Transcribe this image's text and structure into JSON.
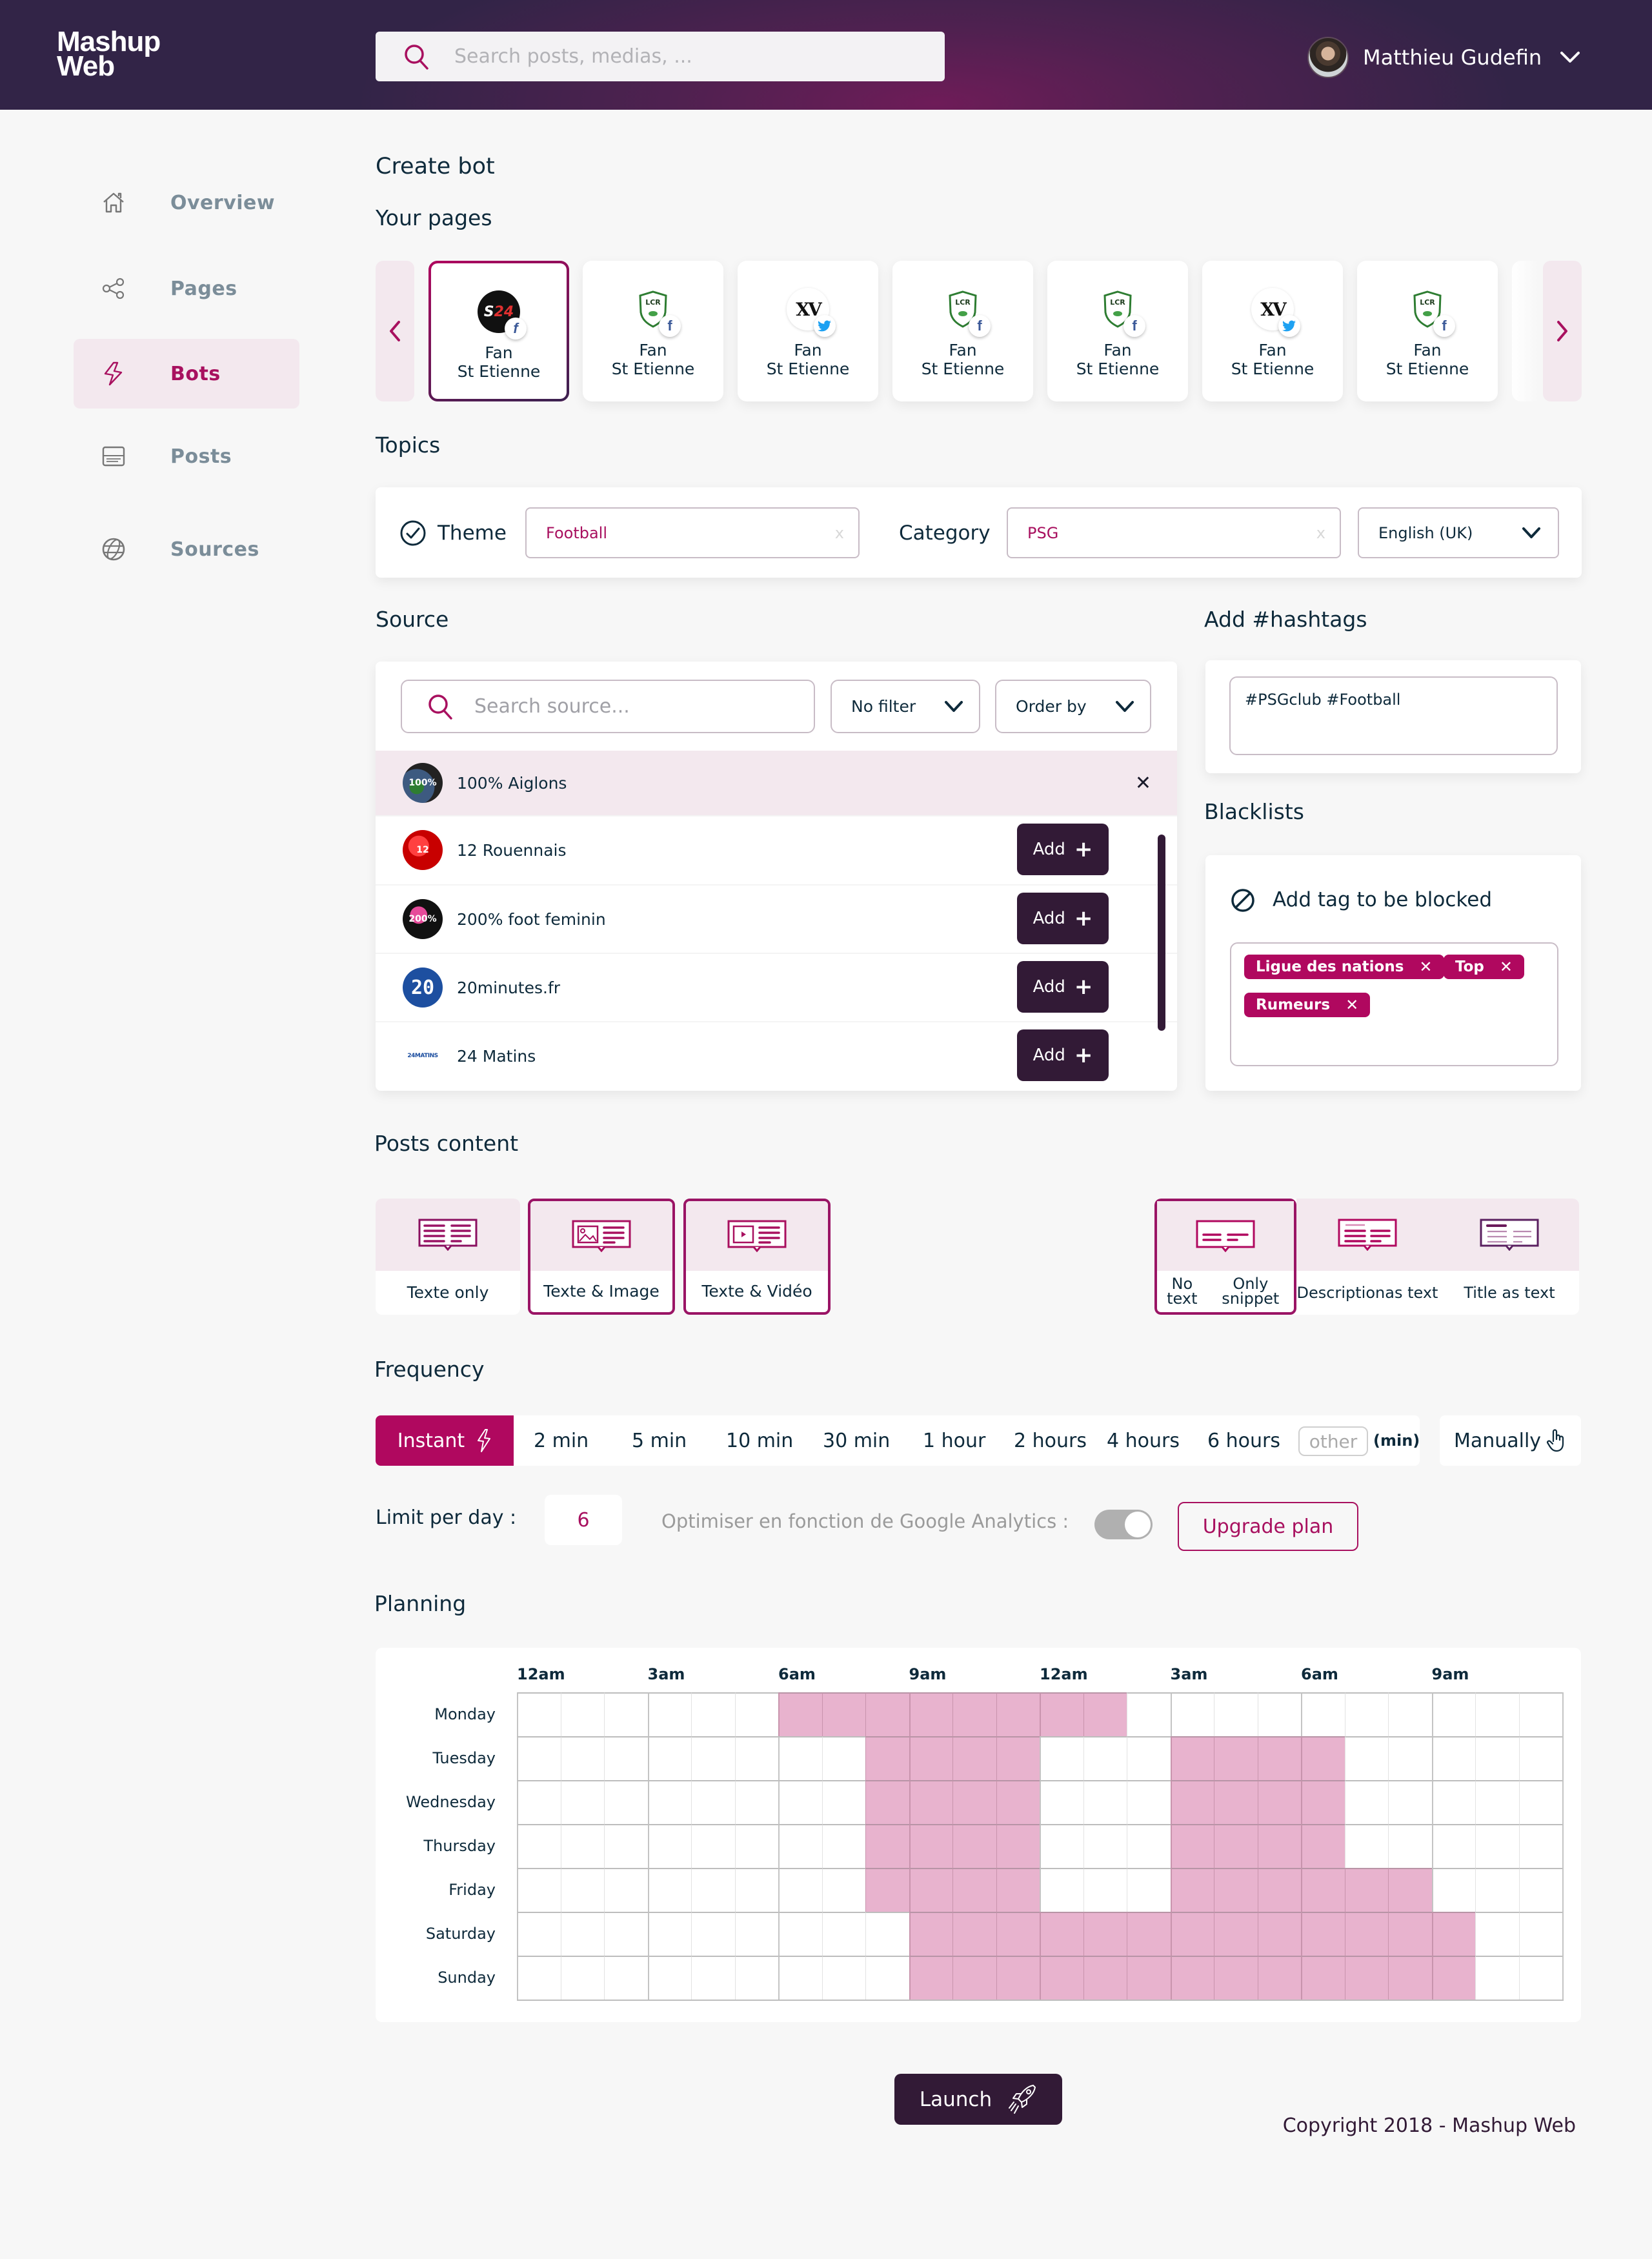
{
  "header": {
    "logo_line1": "Mashup",
    "logo_line2": "Web",
    "search_placeholder": "Search posts, medias, ...",
    "user_name": "Matthieu Gudefin"
  },
  "colors": {
    "accent": "#b0085f",
    "dark": "#321a36",
    "header_from": "#322447",
    "header_to": "#6e1c58",
    "highlight_bg": "#f3e8ee",
    "plan_cell_on": "#e8b3ce"
  },
  "sidebar": {
    "items": [
      {
        "label": "Overview",
        "icon": "home-icon",
        "active": false
      },
      {
        "label": "Pages",
        "icon": "share-icon",
        "active": false
      },
      {
        "label": "Bots",
        "icon": "lightning-icon",
        "active": true
      },
      {
        "label": "Posts",
        "icon": "post-icon",
        "active": false
      },
      {
        "label": "Sources",
        "icon": "globe-icon",
        "active": false
      }
    ]
  },
  "main": {
    "title": "Create bot",
    "pages_title": "Your pages",
    "pages": [
      {
        "line1": "Fan",
        "line2": "St Etienne",
        "logo": "S24",
        "network": "facebook",
        "selected": true
      },
      {
        "line1": "Fan",
        "line2": "St Etienne",
        "logo": "LCR",
        "network": "facebook",
        "selected": false
      },
      {
        "line1": "Fan",
        "line2": "St Etienne",
        "logo": "XV",
        "network": "twitter",
        "selected": false
      },
      {
        "line1": "Fan",
        "line2": "St Etienne",
        "logo": "LCR",
        "network": "facebook",
        "selected": false
      },
      {
        "line1": "Fan",
        "line2": "St Etienne",
        "logo": "LCR",
        "network": "facebook",
        "selected": false
      },
      {
        "line1": "Fan",
        "line2": "St Etienne",
        "logo": "XV",
        "network": "twitter",
        "selected": false
      },
      {
        "line1": "Fan",
        "line2": "St Etienne",
        "logo": "LCR",
        "network": "facebook",
        "selected": false
      }
    ],
    "topics": {
      "title": "Topics",
      "theme_label": "Theme",
      "theme_value": "Football",
      "category_label": "Category",
      "category_value": "PSG",
      "language_value": "English (UK)",
      "clear_glyph": "x"
    },
    "source": {
      "title": "Source",
      "search_placeholder": "Search source...",
      "filter_value": "No filter",
      "order_value": "Order by",
      "add_label": "Add",
      "items": [
        {
          "name": "100% Aiglons",
          "selected": true,
          "avatar_text": "100%"
        },
        {
          "name": "12 Rouennais",
          "selected": false,
          "avatar_text": "12"
        },
        {
          "name": "200% foot feminin",
          "selected": false,
          "avatar_text": "200%"
        },
        {
          "name": "20minutes.fr",
          "selected": false,
          "avatar_text": "20"
        },
        {
          "name": "24 Matins",
          "selected": false,
          "avatar_text": "24MATINS"
        }
      ]
    },
    "hashtags": {
      "title": "Add #hashtags",
      "value": "#PSGclub  #Football"
    },
    "blacklists": {
      "title": "Blacklists",
      "add_label": "Add tag to be blocked",
      "tags": [
        "Ligue des nations",
        "Top",
        "Rumeurs"
      ]
    },
    "posts_content": {
      "title": "Posts content",
      "media_options": [
        {
          "label": "Texte only",
          "selected": false
        },
        {
          "label": "Texte & Image",
          "selected": true
        },
        {
          "label": "Texte & Vidéo",
          "selected": true
        }
      ],
      "text_options": [
        {
          "line1": "No text",
          "line2": "Only snippet",
          "selected": true
        },
        {
          "line1": "Description",
          "line2": "as text",
          "selected": false
        },
        {
          "line1": "Title as text",
          "line2": "",
          "selected": false
        }
      ]
    },
    "frequency": {
      "title": "Frequency",
      "instant_label": "Instant",
      "options": [
        "2 min",
        "5 min",
        "10 min",
        "30 min",
        "1 hour",
        "2 hours",
        "4 hours",
        "6 hours"
      ],
      "selected": "Instant",
      "other_placeholder": "other",
      "other_unit": "(min)",
      "manual_label": "Manually",
      "limit_label": "Limit per day :",
      "limit_value": "6",
      "ga_label": "Optimiser en fonction de Google Analytics :",
      "ga_enabled": false,
      "upgrade_label": "Upgrade plan"
    },
    "planning": {
      "title": "Planning",
      "hour_labels": [
        "12am",
        "3am",
        "6am",
        "9am",
        "12am",
        "3am",
        "6am",
        "9am"
      ],
      "days": [
        "Monday",
        "Tuesday",
        "Wednesday",
        "Thursday",
        "Friday",
        "Saturday",
        "Sunday"
      ],
      "slots_per_day": 24,
      "active_ranges": [
        [
          [
            6,
            13
          ]
        ],
        [
          [
            8,
            11
          ],
          [
            15,
            18
          ]
        ],
        [
          [
            8,
            11
          ],
          [
            15,
            18
          ]
        ],
        [
          [
            8,
            11
          ],
          [
            15,
            18
          ]
        ],
        [
          [
            8,
            11
          ],
          [
            15,
            20
          ]
        ],
        [
          [
            9,
            21
          ]
        ],
        [
          [
            9,
            21
          ]
        ]
      ]
    },
    "launch_label": "Launch"
  },
  "footer": {
    "copyright": "Copyright 2018 - Mashup Web"
  }
}
